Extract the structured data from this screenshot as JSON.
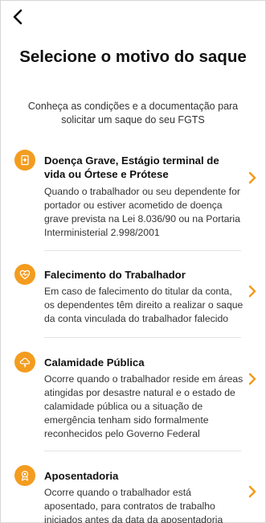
{
  "header": {
    "title": "Selecione o motivo do saque",
    "subtitle": "Conheça as condições e a documentação para solicitar um saque do seu FGTS"
  },
  "items": [
    {
      "icon": "hospital-icon",
      "title": "Doença Grave, Estágio terminal de vida ou Órtese e Prótese",
      "description": "Quando o trabalhador ou seu dependente for portador ou estiver acometido de doença grave prevista na Lei 8.036/90 ou na Portaria Interministerial 2.998/2001"
    },
    {
      "icon": "heart-pulse-icon",
      "title": "Falecimento do Trabalhador",
      "description": "Em caso de falecimento do titular da conta, os dependentes têm direito a realizar o saque da conta vinculada do trabalhador falecido"
    },
    {
      "icon": "storm-cloud-icon",
      "title": "Calamidade Pública",
      "description": "Ocorre quando o trabalhador reside em áreas atingidas por desastre natural e o estado de calamidade pública ou a situação de emergência tenham sido formalmente reconhecidos pelo Governo Federal"
    },
    {
      "icon": "medal-icon",
      "title": "Aposentadoria",
      "description": "Ocorre quando o trabalhador está aposentado, para contratos de trabalho iniciados antes da data da aposentadoria"
    }
  ],
  "colors": {
    "accent": "#f39c1f",
    "text": "#111111",
    "muted": "#333333",
    "divider": "#e3e3e3"
  }
}
